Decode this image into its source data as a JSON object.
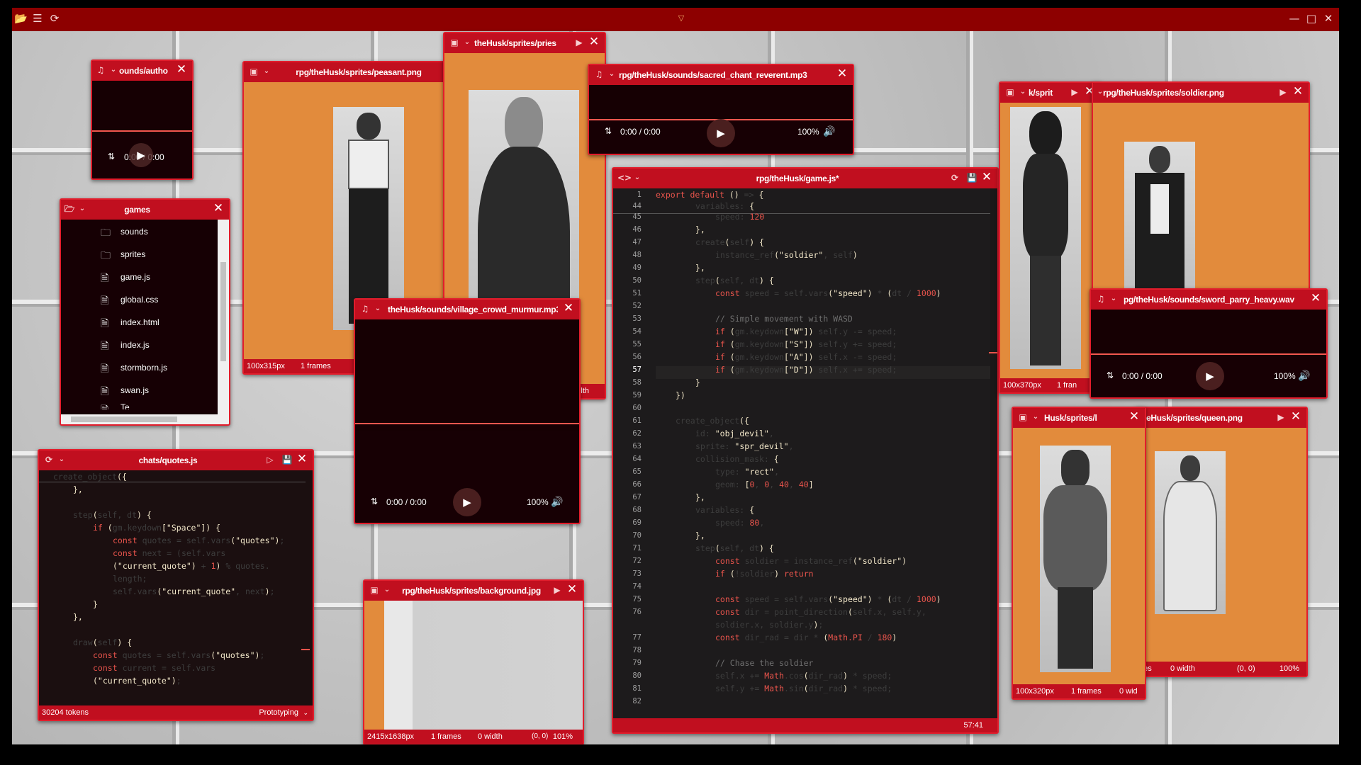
{
  "windows": {
    "sounds_author": {
      "title": "ounds/autho",
      "time": "0:00 / 0:00"
    },
    "games": {
      "title": "games",
      "items": [
        "sounds",
        "sprites",
        "game.js",
        "global.css",
        "index.html",
        "index.js",
        "stormborn.js",
        "swan.js"
      ],
      "partial": "Te"
    },
    "quotes": {
      "title": "chats/quotes.js",
      "tokens": "30204 tokens",
      "mode": "Prototyping"
    },
    "peasant": {
      "title": "rpg/theHusk/sprites/peasant.png",
      "size": "100x315px",
      "frames": "1 frames"
    },
    "priest": {
      "title": "theHusk/sprites/pries",
      "foot": "lth"
    },
    "chant": {
      "title": "rpg/theHusk/sounds/sacred_chant_reverent.mp3",
      "time": "0:00 / 0:00",
      "volume": "100%"
    },
    "village": {
      "title": "theHusk/sounds/village_crowd_murmur.mp3",
      "time": "0:00 / 0:00",
      "volume": "100%"
    },
    "background": {
      "title": "rpg/theHusk/sprites/background.jpg",
      "size": "2415x1638px",
      "frames": "1 frames",
      "width": "0 width",
      "coords": "(0, 0)",
      "zoom": "101%"
    },
    "game": {
      "title": "rpg/theHusk/game.js*",
      "cursor": "57:41"
    },
    "devil": {
      "title": "k/sprit",
      "size": "100x370px",
      "frames": "1 fran"
    },
    "soldier": {
      "title": "rpg/theHusk/sprites/soldier.png"
    },
    "parry": {
      "title": "pg/theHusk/sounds/sword_parry_heavy.wav",
      "time": "0:00 / 0:00",
      "volume": "100%"
    },
    "king": {
      "title": "Husk/sprites/l",
      "size": "100x320px",
      "frames": "1 frames",
      "width": "0 wid"
    },
    "queen": {
      "title": "eHusk/sprites/queen.png",
      "frames": "nes",
      "width": "0 width",
      "coords": "(0, 0)",
      "zoom": "100%"
    }
  },
  "icons": {
    "open_folder": "folder-open-icon",
    "settings": "sliders-icon",
    "sync": "sync-icon",
    "dropdown": "chevron-down-icon",
    "minimize": "minimize-icon",
    "maximize": "maximize-icon",
    "close": "close-icon"
  },
  "accent": "#c10f1f",
  "background_color": "#e28b3c"
}
